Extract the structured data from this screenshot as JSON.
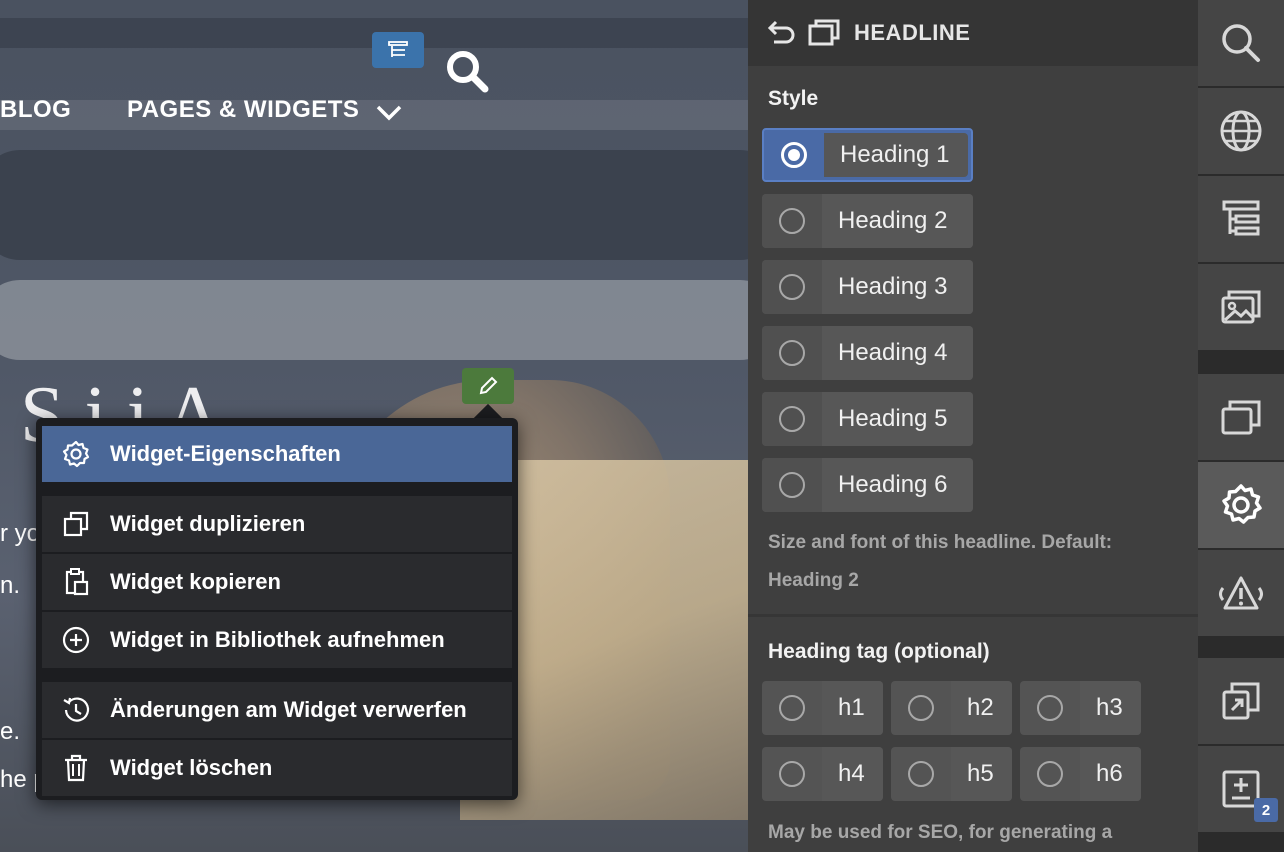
{
  "preview": {
    "nav_blog": "BLOG",
    "nav_pages": "PAGES & WIDGETS",
    "hero_title": "S    i  i   A",
    "body_line1": "r your own website.",
    "body_line2": "n.",
    "body_line3": "e.",
    "body_line4": "he page."
  },
  "context_menu": {
    "items": [
      {
        "label": "Widget-Eigenschaften",
        "icon": "gear-icon"
      },
      {
        "label": "Widget duplizieren",
        "icon": "duplicate-icon"
      },
      {
        "label": "Widget kopieren",
        "icon": "clipboard-icon"
      },
      {
        "label": "Widget in Bibliothek aufnehmen",
        "icon": "plus-circle-icon"
      },
      {
        "label": "Änderungen am Widget verwerfen",
        "icon": "history-icon"
      },
      {
        "label": "Widget löschen",
        "icon": "trash-icon"
      }
    ]
  },
  "panel": {
    "title": "HEADLINE",
    "style_title": "Style",
    "headings": [
      "Heading 1",
      "Heading 2",
      "Heading 3",
      "Heading 4",
      "Heading 5",
      "Heading 6"
    ],
    "selected_heading": "Heading 1",
    "style_help": "Size and font of this headline. Default: Heading 2",
    "tag_title": "Heading tag (optional)",
    "tags": [
      "h1",
      "h2",
      "h3",
      "h4",
      "h5",
      "h6"
    ],
    "tag_help": "May be used for SEO, for generating a"
  },
  "sidebar": {
    "icons": [
      "search-icon",
      "globe-icon",
      "structure-icon",
      "images-icon",
      "windows-icon",
      "gear-icon",
      "warning-icon",
      "copy-icon",
      "add-list-icon"
    ],
    "badge": "2"
  },
  "colors": {
    "accent": "#4a6aa6",
    "panel_bg": "#3f3f3f",
    "menu_bg": "#1c1d20",
    "edit_green": "#4c7a3c"
  }
}
